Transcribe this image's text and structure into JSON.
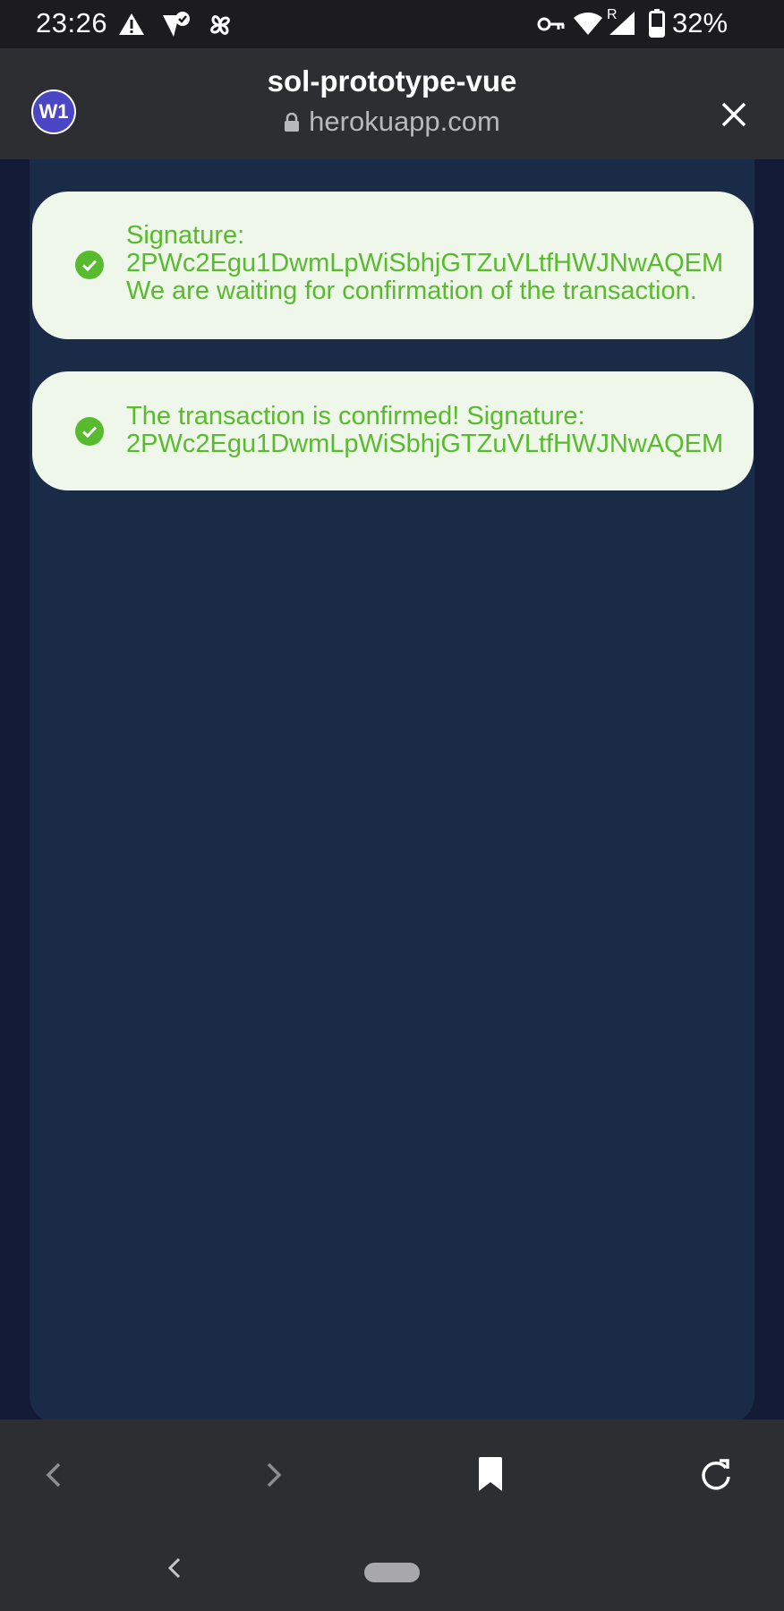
{
  "status_bar": {
    "time": "23:26",
    "battery": "32%",
    "network_label": "R",
    "icons": [
      "alert-icon",
      "vpn-shield-icon",
      "pinwheel-icon",
      "key-icon",
      "wifi-icon",
      "signal-icon",
      "battery-icon"
    ]
  },
  "header": {
    "avatar": "W1",
    "title": "sol-prototype-vue",
    "domain": "herokuapp.com"
  },
  "toasts": [
    {
      "lines": [
        "Signature:",
        "2PWc2Egu1DwmLpWiSbhjGTZuVLtfHWJNwAQEM",
        "We are waiting for confirmation of the transaction."
      ]
    },
    {
      "lines": [
        "The transaction is confirmed! Signature:",
        "2PWc2Egu1DwmLpWiSbhjGTZuVLtfHWJNwAQEM"
      ]
    }
  ],
  "colors": {
    "toast_bg": "#eff7ea",
    "toast_text": "#58bb2e",
    "avatar_bg": "#4a46c4",
    "page_bg": "#192b47"
  }
}
